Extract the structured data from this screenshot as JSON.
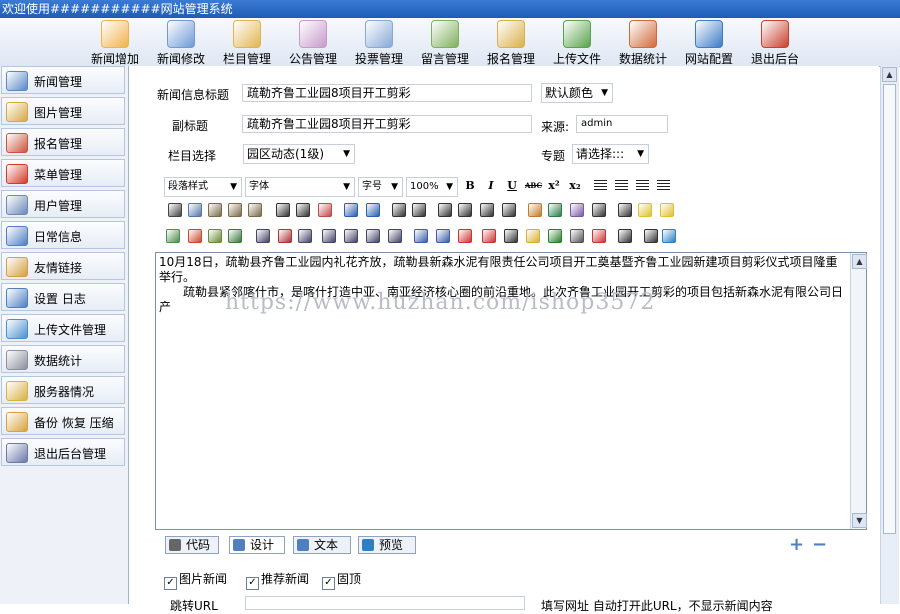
{
  "window": {
    "title": "欢迎使用###########网站管理系统"
  },
  "toolbar": {
    "items": [
      {
        "label": "新闻增加",
        "icon": "news-add-icon",
        "color": "#f0b24a"
      },
      {
        "label": "新闻修改",
        "icon": "news-edit-icon",
        "color": "#6e9ad6"
      },
      {
        "label": "栏目管理",
        "icon": "column-manage-icon",
        "color": "#e0b550"
      },
      {
        "label": "公告管理",
        "icon": "announcement-icon",
        "color": "#c79acb"
      },
      {
        "label": "投票管理",
        "icon": "vote-icon",
        "color": "#88a9d8"
      },
      {
        "label": "留言管理",
        "icon": "message-icon",
        "color": "#7fb05a"
      },
      {
        "label": "报名管理",
        "icon": "signup-icon",
        "color": "#d9b04a"
      },
      {
        "label": "上传文件",
        "icon": "upload-icon",
        "color": "#58a34b"
      },
      {
        "label": "数据统计",
        "icon": "statistics-icon",
        "color": "#d06a3a"
      },
      {
        "label": "网站配置",
        "icon": "site-config-icon",
        "color": "#3c7bc6"
      },
      {
        "label": "退出后台",
        "icon": "exit-icon",
        "color": "#c8402e"
      }
    ]
  },
  "sidebar": {
    "items": [
      {
        "label": "新闻管理",
        "icon": "news-manage-icon",
        "color": "#5a87c6"
      },
      {
        "label": "图片管理",
        "icon": "image-manage-icon",
        "color": "#d4a844"
      },
      {
        "label": "报名管理",
        "icon": "signup-manage-icon",
        "color": "#c9553c"
      },
      {
        "label": "菜单管理",
        "icon": "menu-manage-icon",
        "color": "#d23a2a"
      },
      {
        "label": "用户管理",
        "icon": "user-manage-icon",
        "color": "#6b88b8"
      },
      {
        "label": "日常信息",
        "icon": "daily-info-icon",
        "color": "#4f7fc0"
      },
      {
        "label": "友情链接",
        "icon": "friend-link-icon",
        "color": "#d2a040"
      },
      {
        "label": "设置 日志",
        "icon": "settings-log-icon",
        "color": "#4f7fc0"
      },
      {
        "label": "上传文件管理",
        "icon": "upload-manage-icon",
        "color": "#4a8fcf"
      },
      {
        "label": "数据统计",
        "icon": "data-stats-icon",
        "color": "#8a8f9c"
      },
      {
        "label": "服务器情况",
        "icon": "server-status-icon",
        "color": "#d8b044"
      },
      {
        "label": "备份 恢复 压缩",
        "icon": "backup-icon",
        "color": "#d6a33a"
      },
      {
        "label": "退出后台管理",
        "icon": "logout-icon",
        "color": "#6b78a8"
      }
    ]
  },
  "form": {
    "title_label": "新闻信息标题",
    "title_value": "疏勒齐鲁工业园8项目开工剪彩",
    "color_select": "默认颜色",
    "subtitle_label": "副标题",
    "subtitle_value": "疏勒齐鲁工业园8项目开工剪彩",
    "source_label": "来源:",
    "source_value": "admin",
    "column_label": "栏目选择",
    "column_value": "园区动态(1级)",
    "topic_label": "专题",
    "topic_value": "请选择:::"
  },
  "editor": {
    "paragraph_style": "段落样式",
    "font": "字体",
    "font_size": "字号",
    "zoom": "100%",
    "content_line1": "10月18日，疏勒县齐鲁工业园内礼花齐放，疏勒县新森水泥有限责任公司项目开工奠基暨齐鲁工业园新建项目剪彩仪式项目隆重举行。",
    "content_line2": "疏勒县紧邻喀什市，是喀什打造中亚、南亚经济核心圈的前沿重地。此次齐鲁工业园开工剪彩的项目包括新森水泥有限公司日产",
    "watermark": "https://www.huzhan.com/ishop3572",
    "modes": [
      "代码",
      "设计",
      "文本",
      "预览"
    ],
    "format_buttons": [
      "B",
      "I",
      "U",
      "ABC",
      "x²",
      "x₂"
    ]
  },
  "options": {
    "checkboxes": [
      {
        "label": "图片新闻",
        "checked": true
      },
      {
        "label": "推荐新闻",
        "checked": true
      },
      {
        "label": "固顶",
        "checked": true
      }
    ],
    "bottom_label": "跳转URL",
    "bottom_hint": "填写网址 自动打开此URL，不显示新闻内容"
  }
}
